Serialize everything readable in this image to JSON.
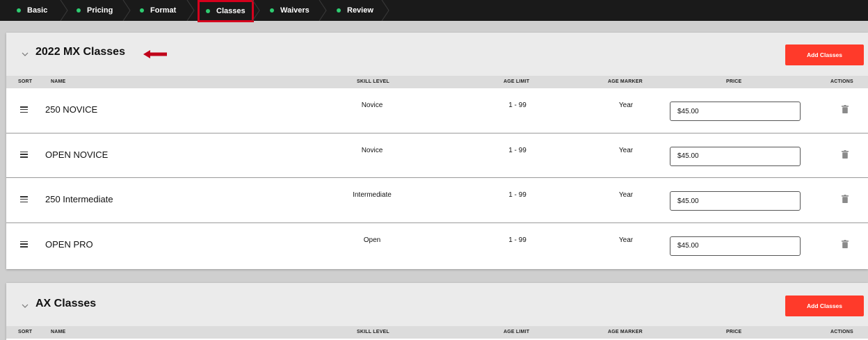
{
  "wizard": {
    "steps": [
      {
        "label": "Basic"
      },
      {
        "label": "Pricing"
      },
      {
        "label": "Format"
      },
      {
        "label": "Classes"
      },
      {
        "label": "Waivers"
      },
      {
        "label": "Review"
      }
    ],
    "active_step": "Classes",
    "accent": "#2ecc71",
    "highlight_color": "#d4001c"
  },
  "table_headers": {
    "sort": "SORT",
    "name": "NAME",
    "skill": "SKILL LEVEL",
    "age_limit": "AGE LIMIT",
    "age_marker": "AGE MARKER",
    "price": "PRICE",
    "actions": "ACTIONS"
  },
  "sections": [
    {
      "title": "2022 MX Classes",
      "add_label": "Add Classes",
      "rows": [
        {
          "name": "250 NOVICE",
          "skill": "Novice",
          "age_limit": "1 - 99",
          "age_marker": "Year",
          "price": "$45.00"
        },
        {
          "name": "OPEN NOVICE",
          "skill": "Novice",
          "age_limit": "1 - 99",
          "age_marker": "Year",
          "price": "$45.00"
        },
        {
          "name": "250 Intermediate",
          "skill": "Intermediate",
          "age_limit": "1 - 99",
          "age_marker": "Year",
          "price": "$45.00"
        },
        {
          "name": "OPEN PRO",
          "skill": "Open",
          "age_limit": "1 - 99",
          "age_marker": "Year",
          "price": "$45.00"
        }
      ]
    },
    {
      "title": "AX Classes",
      "add_label": "Add Classes",
      "rows": []
    }
  ],
  "icons": [
    "chevron-down-icon",
    "drag-handle-icon",
    "trash-icon",
    "arrow-left-icon"
  ],
  "colors": {
    "add_button": "#ff3a2a",
    "annotation_arrow": "#c0001a"
  }
}
